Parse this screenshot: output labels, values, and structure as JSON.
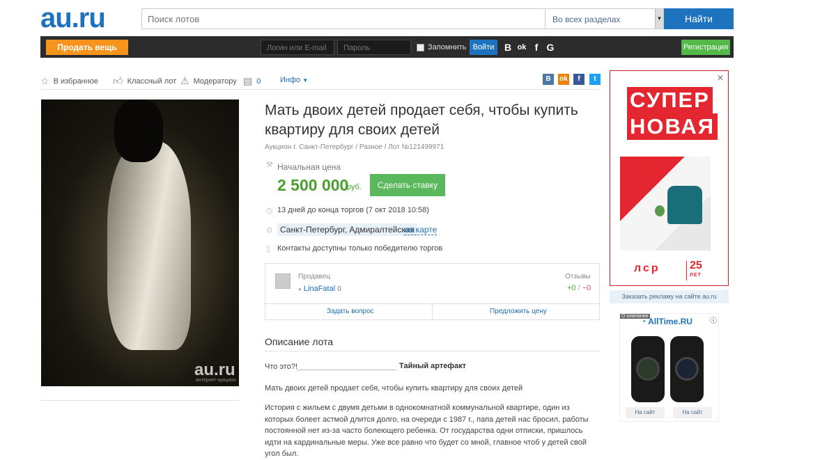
{
  "header": {
    "logo": "au.ru",
    "search_placeholder": "Поиск лотов",
    "scope": "Во всех разделах",
    "find_label": "Найти"
  },
  "topbar": {
    "sell_label": "Продать вещь",
    "login_placeholder": "Логин или E-mail",
    "password_placeholder": "Пароль",
    "remember_label": "Запомнить",
    "enter_label": "Войти",
    "social": [
      "В",
      "ok",
      "f",
      "G"
    ],
    "register_label": "Регистрация"
  },
  "actions": {
    "favorite": "В избранное",
    "like": "Классный лот",
    "moderator": "Модератору",
    "comments_count": "0",
    "info": "Инфо"
  },
  "share": [
    {
      "label": "В",
      "color": "#4a76a8"
    },
    {
      "label": "ok",
      "color": "#ee8208"
    },
    {
      "label": "f",
      "color": "#3b5998"
    },
    {
      "label": "t",
      "color": "#1da1f2"
    }
  ],
  "photo": {
    "watermark": "au.ru",
    "watermark_sub": "интернет-аукцион"
  },
  "lot": {
    "title": "Мать двоих детей продает себя, чтобы купить квартиру для своих детей",
    "breadcrumbs": "Аукцион г. Санкт-Петербург / Разное / Лот №121499971",
    "price_label": "Начальная цена",
    "price": "2 500 000",
    "currency": "руб.",
    "bid_label": "Сделать ставку",
    "time_left": "13 дней до конца торгов (7 окт 2018 10:58)",
    "location": "Санкт-Петербург, Адмиралтейская",
    "map_link": "на карте",
    "contacts": "Контакты доступны только победителю торгов"
  },
  "seller": {
    "label": "Продавец",
    "name": "LinaFatal",
    "rating": "0",
    "reviews_label": "Отзывы",
    "reviews_pos": "+0",
    "reviews_neg": "−0",
    "ask_label": "Задать вопрос",
    "offer_label": "Предложить цену"
  },
  "description": {
    "heading": "Описание лота",
    "what_label": "Что это?!",
    "what_value": "Тайный артефакт",
    "p1": "Мать двоих детей продает себя, чтобы купить квартиру для своих детей",
    "p2": "История с жильем с двумя детьми в однокомнатной коммунальной квартире, один из которых болеет астмой длится долго, на очереди с 1987 г., папа детей нас бросил, работы постоянной нет из-за часто болеющего ребенка. От государства одни отписки, пришлось идти на кардинальные меры. Уже все равно что будет со мной, главное чтоб у детей свой угол был."
  },
  "ad": {
    "line1": "СУПЕР",
    "line2": "НОВАЯ",
    "brand": "лср",
    "years": "25",
    "years_sub": "ЛЕТ",
    "advertise_link": "Заказать рекламу на сайте au.ru"
  },
  "ad2": {
    "tag": "О компании",
    "brand": "AllTime.RU",
    "buy1": "На сайт",
    "buy2": "На сайт"
  }
}
